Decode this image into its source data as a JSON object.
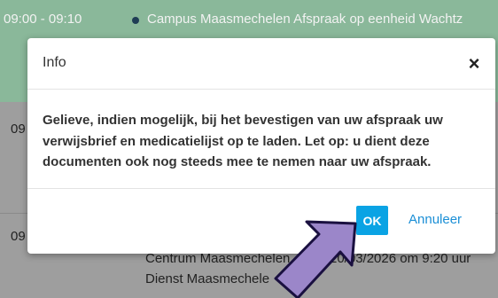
{
  "background": {
    "appointment_time": "09:00 - 09:10",
    "appointment_title": "Campus Maasmechelen Afspraak op eenheid Wachtz",
    "row2_time": "09",
    "row3_time": "09",
    "row3_detail": "Centrum Maasmechelen",
    "row3_date": "20/03/2026 om 9:20 uur",
    "row3_service": "Dienst Maasmechele"
  },
  "modal": {
    "title": "Info",
    "close_label": "×",
    "message": "Gelieve, indien mogelijk, bij het bevestigen van uw afspraak uw verwijsbrief en medicatielijst op te laden. Let op: u dient deze documenten ook nog steeds mee te nemen naar uw afspraak.",
    "ok_label": "OK",
    "cancel_label": "Annuleer"
  },
  "colors": {
    "ok_button": "#0aa3e4",
    "cancel_link": "#1b8fd6",
    "arrow_fill": "#9b86c9",
    "arrow_stroke": "#1a1040"
  },
  "icons": {
    "close": "close-icon",
    "pointer": "arrow-annotation"
  }
}
